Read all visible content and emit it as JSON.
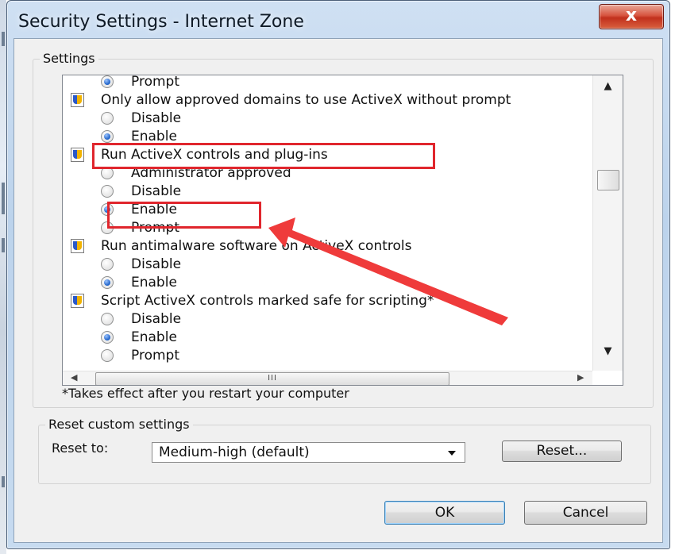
{
  "window": {
    "title": "Security Settings - Internet Zone",
    "close_label": "x"
  },
  "settings": {
    "group_label": "Settings",
    "rows": [
      {
        "kind": "option",
        "label": "Prompt",
        "checked": true
      },
      {
        "kind": "header",
        "label": "Only allow approved domains to use ActiveX without prompt"
      },
      {
        "kind": "option",
        "label": "Disable",
        "checked": false
      },
      {
        "kind": "option",
        "label": "Enable",
        "checked": true
      },
      {
        "kind": "header",
        "label": "Run ActiveX controls and plug-ins"
      },
      {
        "kind": "option",
        "label": "Administrator approved",
        "checked": false
      },
      {
        "kind": "option",
        "label": "Disable",
        "checked": false
      },
      {
        "kind": "option",
        "label": "Enable",
        "checked": true
      },
      {
        "kind": "option",
        "label": "Prompt",
        "checked": false
      },
      {
        "kind": "header",
        "label": "Run antimalware software on ActiveX controls"
      },
      {
        "kind": "option",
        "label": "Disable",
        "checked": false
      },
      {
        "kind": "option",
        "label": "Enable",
        "checked": true
      },
      {
        "kind": "header",
        "label": "Script ActiveX controls marked safe for scripting*"
      },
      {
        "kind": "option",
        "label": "Disable",
        "checked": false
      },
      {
        "kind": "option",
        "label": "Enable",
        "checked": true
      },
      {
        "kind": "option",
        "label": "Prompt",
        "checked": false
      }
    ],
    "hscroll_grip": "III",
    "footnote": "*Takes effect after you restart your computer"
  },
  "reset": {
    "group_label": "Reset custom settings",
    "reset_to_label": "Reset to:",
    "dropdown_value": "Medium-high (default)",
    "reset_button": "Reset..."
  },
  "buttons": {
    "ok": "OK",
    "cancel": "Cancel"
  },
  "annotation": {
    "color": "#e0262d"
  }
}
